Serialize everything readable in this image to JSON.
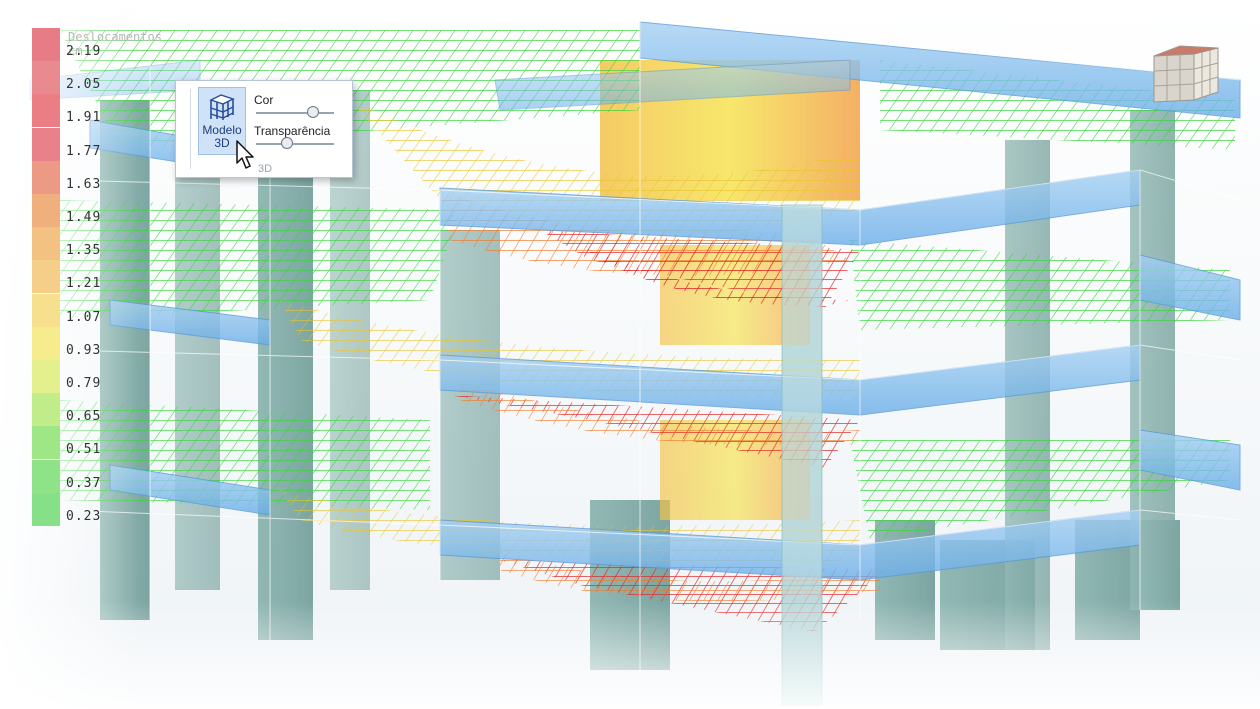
{
  "legend": {
    "unit": "Deslocamentos cm",
    "values": [
      "2.19",
      "2.05",
      "1.91",
      "1.77",
      "1.63",
      "1.49",
      "1.35",
      "1.21",
      "1.07",
      "0.93",
      "0.79",
      "0.65",
      "0.51",
      "0.37",
      "0.23"
    ],
    "colors": [
      "#e87c86",
      "#e98a8e",
      "#ea7e84",
      "#e9818a",
      "#ec9a86",
      "#f0b07e",
      "#f3c182",
      "#f5cf8a",
      "#f6e08e",
      "#f6ec8e",
      "#e4f08e",
      "#c1ec8a",
      "#9ee686",
      "#8ee287",
      "#86e087"
    ]
  },
  "ribbon": {
    "button_label_1": "Modelo",
    "button_label_2": "3D",
    "slider_color_label": "Cor",
    "slider_color_value": 0.78,
    "slider_transparency_label": "Transparência",
    "slider_transparency_value": 0.38,
    "group_label": "3D"
  },
  "icons": {
    "model": "building-3d-icon",
    "cursor": "mouse-pointer-icon",
    "cube": "view-cube-icon"
  },
  "colors": {
    "column": "#6f9f9a",
    "beam": "#7fb9ec",
    "deflection_low": "#3fdc3a",
    "deflection_mid": "#f0e030",
    "deflection_high": "#e81818"
  }
}
